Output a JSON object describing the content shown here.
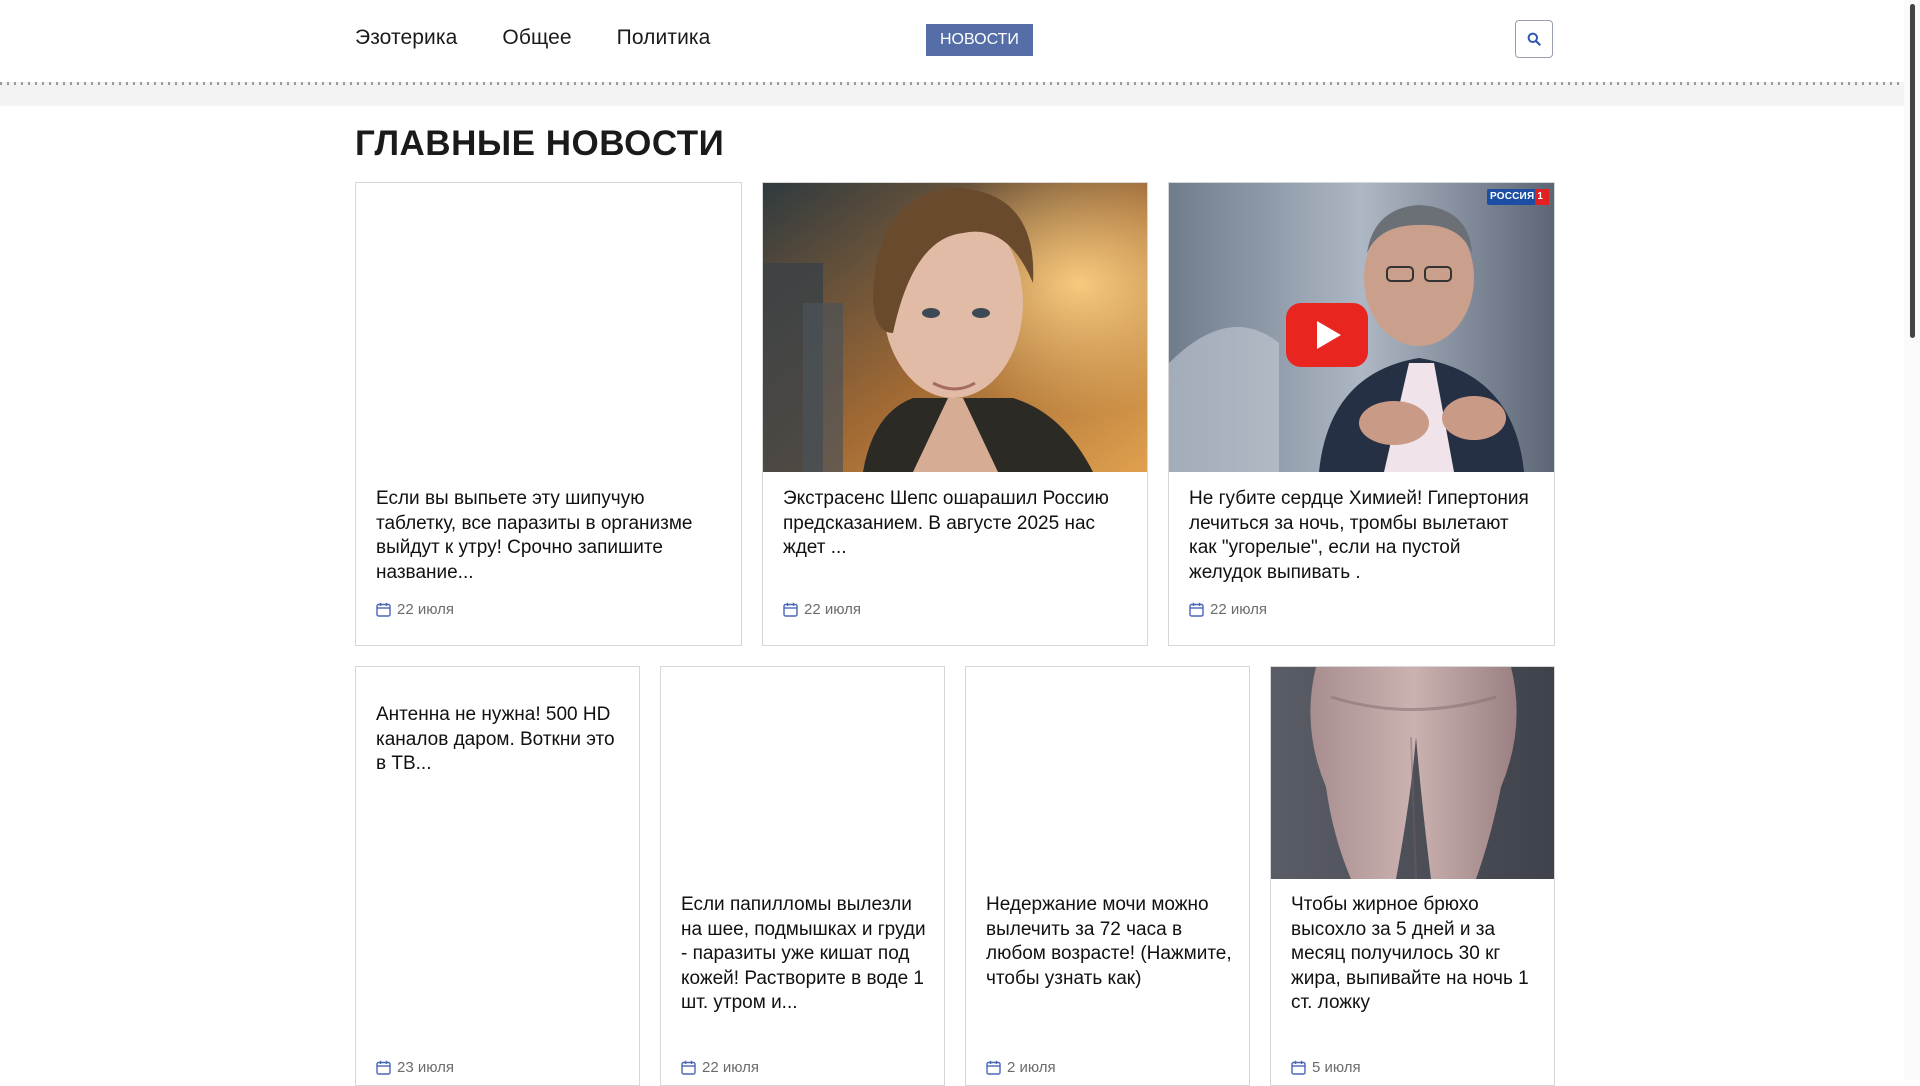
{
  "nav": {
    "links": [
      "Эзотерика",
      "Общее",
      "Политика"
    ],
    "news_button": "НОВОСТИ",
    "search_icon": "search-icon"
  },
  "section": {
    "title": "ГЛАВНЫЕ НОВОСТИ"
  },
  "colors": {
    "accent": "#556ea7",
    "date_icon": "#4a67b5",
    "play_button": "#e8251f"
  },
  "cards": [
    {
      "title": "Если вы выпьете эту шипучую таблетку, все паразиты в организме выйдут к утру! Срочно запишите название...",
      "date": "22 июля"
    },
    {
      "title": "Экстрасенс Шепс ошарашил Россию предсказанием. В августе 2025 нас ждет ...",
      "date": "22 июля"
    },
    {
      "title": "Не губите сердце Химией! Гипертония лечиться за ночь, тромбы вылетают как \"угорелые\", если на пустой желудок выпивать .",
      "date": "22 июля",
      "channel_logo": "РОССИЯ 1"
    },
    {
      "title": "Антенна не нужна! 500 HD каналов даром. Воткни это в ТВ...",
      "date": "23 июля"
    },
    {
      "title": "Если папилломы вылезли на шее, подмышках и груди - паразиты уже кишат под кожей! Растворите в воде 1 шт. утром и...",
      "date": "22 июля"
    },
    {
      "title": "Недержание мочи можно вылечить за 72 часа в любом возрасте! (Нажмите, чтобы узнать как)",
      "date": "2 июля"
    },
    {
      "title": "Чтобы жирное брюхо высохло за 5 дней и за месяц получилось 30 кг жира, выпивайте на ночь 1 ст. ложку",
      "date": "5 июля"
    }
  ]
}
